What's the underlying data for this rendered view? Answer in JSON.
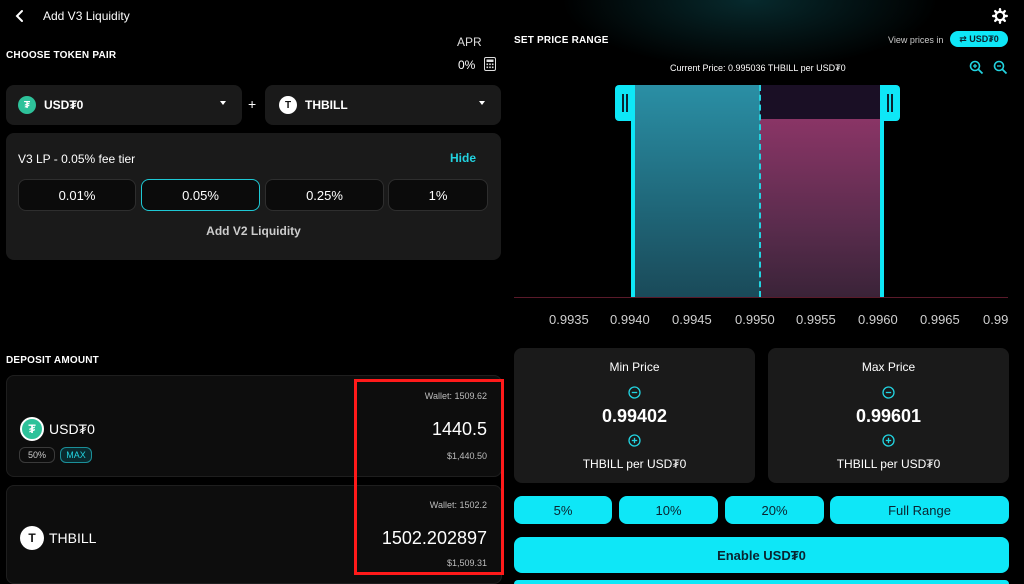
{
  "header": {
    "title": "Add V3 Liquidity"
  },
  "apr": {
    "label": "APR",
    "value": "0%"
  },
  "token_pair": {
    "title": "CHOOSE TOKEN PAIR",
    "token_a": "USD₮0",
    "plus": "+",
    "token_b": "THBILL"
  },
  "fee_tier": {
    "label": "V3 LP - 0.05% fee tier",
    "hide_label": "Hide",
    "options": [
      "0.01%",
      "0.05%",
      "0.25%",
      "1%"
    ],
    "selected_index": 1,
    "v2_label": "Add V2 Liquidity"
  },
  "price_range": {
    "title": "SET PRICE RANGE",
    "view_prices_label": "View prices in",
    "view_token": "⇄ USD₮0",
    "current_price": "Current Price: 0.995036 THBILL per USD₮0",
    "ticks": [
      "0.9935",
      "0.9940",
      "0.9945",
      "0.9950",
      "0.9955",
      "0.9960",
      "0.9965",
      "0.99"
    ]
  },
  "min_price": {
    "label": "Min Price",
    "value": "0.99402",
    "unit": "THBILL per USD₮0"
  },
  "max_price": {
    "label": "Max Price",
    "value": "0.99601",
    "unit": "THBILL per USD₮0"
  },
  "range_buttons": [
    "5%",
    "10%",
    "20%",
    "Full Range"
  ],
  "enable_button": "Enable USD₮0",
  "deposit": {
    "title": "DEPOSIT AMOUNT",
    "token_a": {
      "name": "USD₮0",
      "wallet": "Wallet: 1509.62",
      "amount": "1440.5",
      "usd": "$1,440.50",
      "half": "50%",
      "max": "MAX"
    },
    "token_b": {
      "name": "THBILL",
      "wallet": "Wallet: 1502.2",
      "amount": "1502.202897",
      "usd": "$1,509.31"
    }
  },
  "colors": {
    "accent": "#0ee7f7",
    "highlight": "#ff1a1a"
  }
}
